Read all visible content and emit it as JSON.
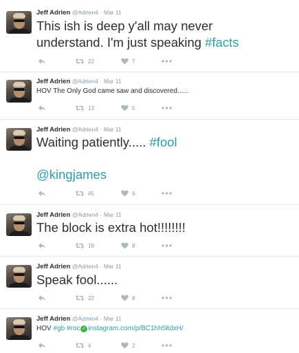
{
  "tweets": [
    {
      "name": "Jeff Adrien",
      "handle": "@Adrien4",
      "separator": "·",
      "date": "Mar 11",
      "text_plain": "This ish is deep y'all may never",
      "text_line2": "understand. I'm just speaking ",
      "hashtag": "#facts",
      "retweets": "22",
      "likes": "7"
    },
    {
      "name": "Jeff Adrien",
      "handle": "@Adrien4",
      "separator": "·",
      "date": "Mar 11",
      "text": "HOV The Only God came saw and discovered......",
      "retweets": "13",
      "likes": "5"
    },
    {
      "name": "Jeff Adrien",
      "handle": "@Adrien4",
      "separator": "·",
      "date": "Mar 11",
      "text_plain": "Waiting patiently..... ",
      "hashtag": "#fool",
      "mention": "@kingjames",
      "retweets": "45",
      "likes": "9"
    },
    {
      "name": "Jeff Adrien",
      "handle": "@Adrien4",
      "separator": "·",
      "date": "Mar 11",
      "text": "The block is extra hot!!!!!!!!",
      "retweets": "19",
      "likes": "8"
    },
    {
      "name": "Jeff Adrien",
      "handle": "@Adrien4",
      "separator": "·",
      "date": "Mar 11",
      "text": "Speak fool......",
      "retweets": "22",
      "likes": "8"
    },
    {
      "name": "Jeff Adrien",
      "handle": "@Adrien4",
      "separator": "·",
      "date": "Mar 11",
      "text_prefix": "HOV ",
      "hashtag1": "#gb",
      "hashtag2": "#roc",
      "link": "instagram.com/p/BC1hh5ltdxH/",
      "retweets": "4",
      "likes": "2"
    }
  ],
  "icons": {
    "reply": "reply-icon",
    "retweet": "retweet-icon",
    "like": "heart-icon",
    "more": "more-icon",
    "verified": "check-icon"
  },
  "colors": {
    "hashtag": "#2b9ea8",
    "meta": "#8899a6",
    "text": "#292f33",
    "separator": "#e1e8ed"
  }
}
